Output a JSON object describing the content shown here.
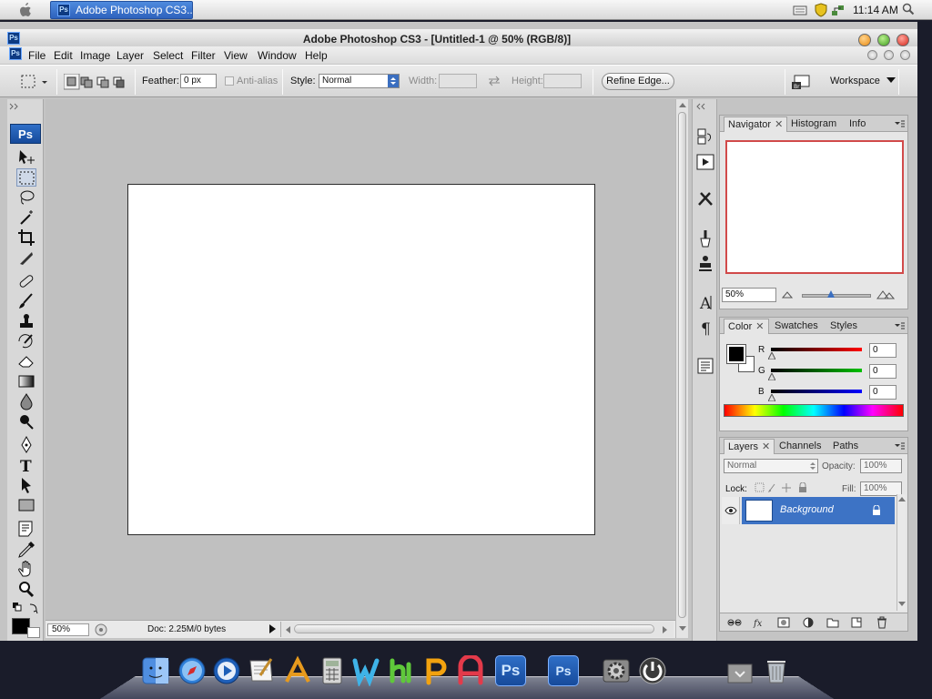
{
  "system": {
    "task_button": "Adobe Photoshop CS3...",
    "clock": "11:14 AM"
  },
  "window": {
    "title": "Adobe Photoshop CS3 - [Untitled-1 @ 50% (RGB/8)]"
  },
  "menu": {
    "items": [
      "File",
      "Edit",
      "Image",
      "Layer",
      "Select",
      "Filter",
      "View",
      "Window",
      "Help"
    ]
  },
  "options": {
    "feather_label": "Feather:",
    "feather_value": "0 px",
    "antialias_label": "Anti-alias",
    "style_label": "Style:",
    "style_value": "Normal",
    "width_label": "Width:",
    "height_label": "Height:",
    "refine_edge": "Refine Edge...",
    "workspace": "Workspace"
  },
  "toolbox": {
    "logo": "Ps",
    "tool_icons": [
      "move-icon",
      "marquee-icon",
      "lasso-icon",
      "magic-wand-icon",
      "crop-icon",
      "slice-icon",
      "healing-icon",
      "brush-icon",
      "stamp-icon",
      "history-brush-icon",
      "eraser-icon",
      "gradient-icon",
      "blur-icon",
      "dodge-icon",
      "pen-icon",
      "type-icon",
      "path-select-icon",
      "shape-icon",
      "notes-icon",
      "eyedropper-icon",
      "hand-icon",
      "zoom-icon"
    ],
    "foreground_color": "#000000",
    "background_color": "#ffffff"
  },
  "status": {
    "zoom": "50%",
    "doc_info": "Doc: 2.25M/0 bytes"
  },
  "navigator": {
    "tabs": [
      "Navigator",
      "Histogram",
      "Info"
    ],
    "zoom": "50%"
  },
  "color_panel": {
    "tabs": [
      "Color",
      "Swatches",
      "Styles"
    ],
    "channels": [
      {
        "label": "R",
        "value": "0",
        "color": "#ff0000"
      },
      {
        "label": "G",
        "value": "0",
        "color": "#00c000"
      },
      {
        "label": "B",
        "value": "0",
        "color": "#0000ff"
      }
    ]
  },
  "layers_panel": {
    "tabs": [
      "Layers",
      "Channels",
      "Paths"
    ],
    "blend_mode": "Normal",
    "opacity_label": "Opacity:",
    "opacity_value": "100%",
    "lock_label": "Lock:",
    "fill_label": "Fill:",
    "fill_value": "100%",
    "layer_name": "Background"
  },
  "colors": {
    "selection_blue": "#3d73c5",
    "navigator_frame": "#d14a4a"
  }
}
